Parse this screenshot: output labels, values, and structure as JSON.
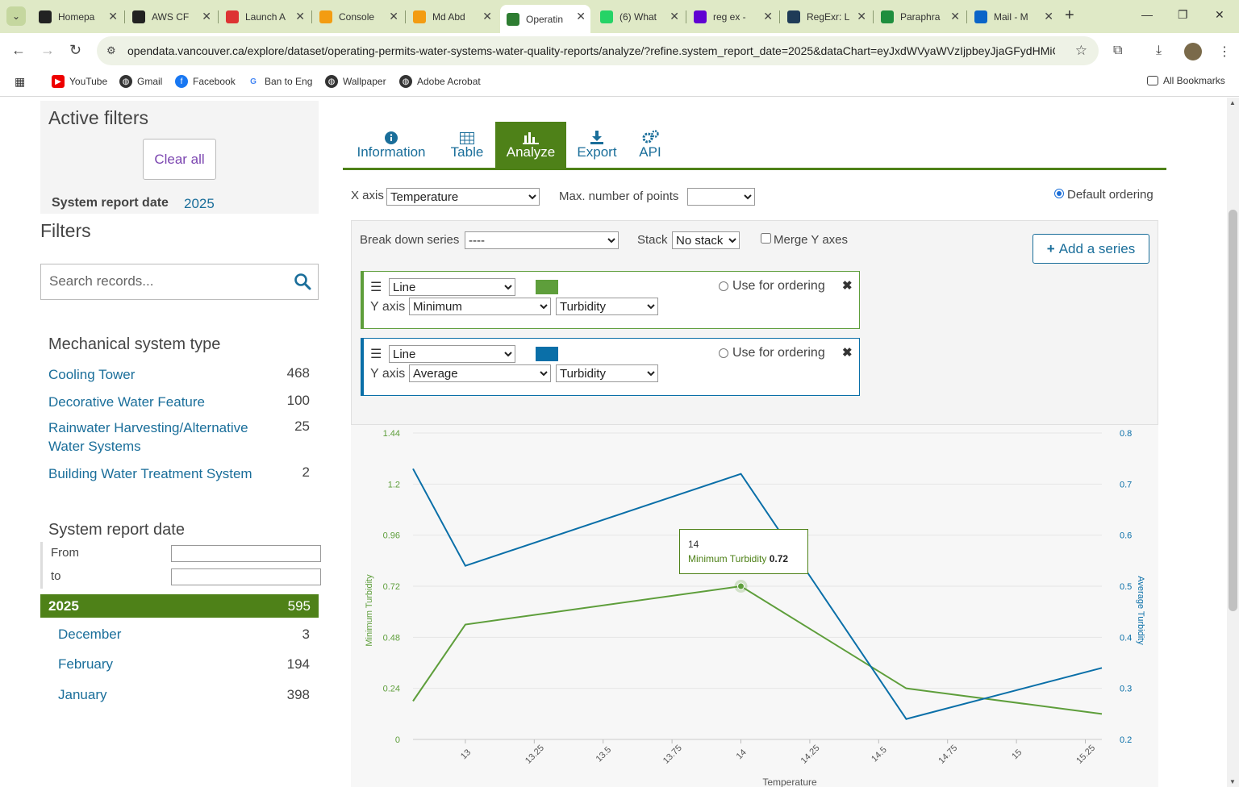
{
  "browser": {
    "tabs": [
      {
        "title": "Homepa",
        "color": "#222"
      },
      {
        "title": "AWS CF",
        "color": "#222"
      },
      {
        "title": "Launch A",
        "color": "#d33"
      },
      {
        "title": "Console",
        "color": "#f39c12"
      },
      {
        "title": "Md Abd",
        "color": "#f39c12"
      },
      {
        "title": "Operatin",
        "color": "#2e7d32"
      },
      {
        "title": "(6) What",
        "color": "#25d366"
      },
      {
        "title": "reg ex -",
        "color": "#6001d2"
      },
      {
        "title": "RegExr: L",
        "color": "#1f3b57"
      },
      {
        "title": "Paraphra",
        "color": "#1e8e3e"
      },
      {
        "title": "Mail - M",
        "color": "#0a64c8"
      }
    ],
    "url": "opendata.vancouver.ca/explore/dataset/operating-permits-water-systems-water-quality-reports/analyze/?refine.system_report_date=2025&dataChart=eyJxdWVyaWVzIjpbeyJjaGFydHMiOi...",
    "bookmarks": [
      "YouTube",
      "Gmail",
      "Facebook",
      "Ban to Eng",
      "Wallpaper",
      "Adobe Acrobat"
    ],
    "all_bookmarks": "All Bookmarks"
  },
  "sidebar": {
    "active_filters_title": "Active filters",
    "clear_all": "Clear all",
    "active_filter_label": "System report date",
    "active_filter_value": "2025",
    "filters_title": "Filters",
    "search_placeholder": "Search records...",
    "facet1": {
      "title": "Mechanical system type",
      "items": [
        {
          "label": "Cooling Tower",
          "count": "468"
        },
        {
          "label": "Decorative Water Feature",
          "count": "100"
        },
        {
          "label": "Rainwater Harvesting/Alternative Water Systems",
          "count": "25"
        },
        {
          "label": "Building Water Treatment System",
          "count": "2"
        }
      ]
    },
    "facet2": {
      "title": "System report date",
      "from_label": "From",
      "to_label": "to",
      "year": "2025",
      "year_count": "595",
      "months": [
        {
          "label": "December",
          "count": "3"
        },
        {
          "label": "February",
          "count": "194"
        },
        {
          "label": "January",
          "count": "398"
        }
      ]
    }
  },
  "main": {
    "tabs": [
      {
        "label": "Information",
        "icon": "info-icon"
      },
      {
        "label": "Table",
        "icon": "table-icon"
      },
      {
        "label": "Analyze",
        "icon": "bar-chart-icon"
      },
      {
        "label": "Export",
        "icon": "download-icon"
      },
      {
        "label": "API",
        "icon": "gears-icon"
      }
    ],
    "xaxis_label": "X axis",
    "xaxis_value": "Temperature",
    "maxpoints_label": "Max. number of points",
    "maxpoints_value": "",
    "default_ordering": "Default ordering",
    "breakdown_label": "Break down series",
    "breakdown_value": "----",
    "stack_label": "Stack",
    "stack_value": "No stack",
    "merge_label": "Merge Y axes",
    "add_series": "Add a series",
    "series": [
      {
        "type": "Line",
        "color": "#5e9e3b",
        "yaxis_label": "Y axis",
        "func": "Minimum",
        "field": "Turbidity",
        "order_label": "Use for ordering"
      },
      {
        "type": "Line",
        "color": "#0a6fa8",
        "yaxis_label": "Y axis",
        "func": "Average",
        "field": "Turbidity",
        "order_label": "Use for ordering"
      }
    ],
    "tooltip": {
      "x": "14",
      "series": "Minimum Turbidity",
      "value": "0.72"
    }
  },
  "chart_data": {
    "type": "line",
    "xlabel": "Temperature",
    "x_ticks": [
      "13",
      "13.25",
      "13.5",
      "13.75",
      "14",
      "14.25",
      "14.5",
      "14.75",
      "15",
      "15.25"
    ],
    "left_axis": {
      "label": "Minimum Turbidity",
      "ticks": [
        "0",
        "0.24",
        "0.48",
        "0.72",
        "0.96",
        "1.2",
        "1.44"
      ],
      "ylim": [
        0,
        1.44
      ]
    },
    "right_axis": {
      "label": "Average Turbidity",
      "ticks": [
        "0.2",
        "0.3",
        "0.4",
        "0.5",
        "0.6",
        "0.7",
        "0.8"
      ],
      "ylim": [
        0.2,
        0.8
      ]
    },
    "xlim": [
      12.81,
      15.31
    ],
    "series": [
      {
        "name": "Minimum Turbidity",
        "axis": "left",
        "color": "#5e9e3b",
        "x": [
          12.81,
          13.0,
          14.0,
          14.6,
          15.31
        ],
        "values": [
          0.18,
          0.54,
          0.72,
          0.24,
          0.12
        ]
      },
      {
        "name": "Average Turbidity",
        "axis": "right",
        "color": "#0a6fa8",
        "x": [
          12.81,
          13.0,
          14.0,
          14.6,
          15.31
        ],
        "values": [
          0.73,
          0.54,
          0.72,
          0.24,
          0.34
        ]
      }
    ],
    "grid": true
  }
}
